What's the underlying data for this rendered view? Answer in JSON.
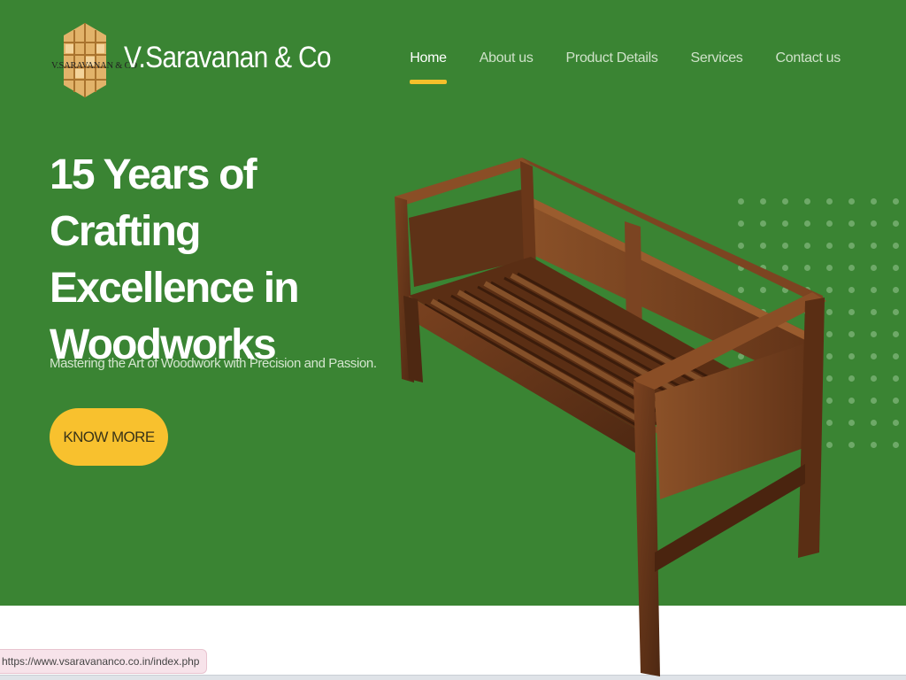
{
  "header": {
    "logo_small_text": "V.SARAVANAN & CO",
    "brand_name": "V.Saravanan & Co"
  },
  "nav": {
    "items": [
      {
        "label": "Home",
        "active": true
      },
      {
        "label": "About us",
        "active": false
      },
      {
        "label": "Product Details",
        "active": false
      },
      {
        "label": "Services",
        "active": false
      },
      {
        "label": "Contact us",
        "active": false
      }
    ]
  },
  "hero": {
    "headline_line1": "15 Years of Crafting",
    "headline_line2": "Excellence in",
    "headline_line3": "Woodworks",
    "subtitle": "Mastering the Art of Woodwork with Precision and Passion.",
    "cta_label": "KNOW MORE",
    "image": "wooden-bench"
  },
  "status_bar": {
    "url": "https://www.vsaravananco.co.in/index.php"
  },
  "colors": {
    "hero_bg": "#3a8433",
    "accent": "#f8c12e",
    "wood": "#6b3a1c"
  }
}
